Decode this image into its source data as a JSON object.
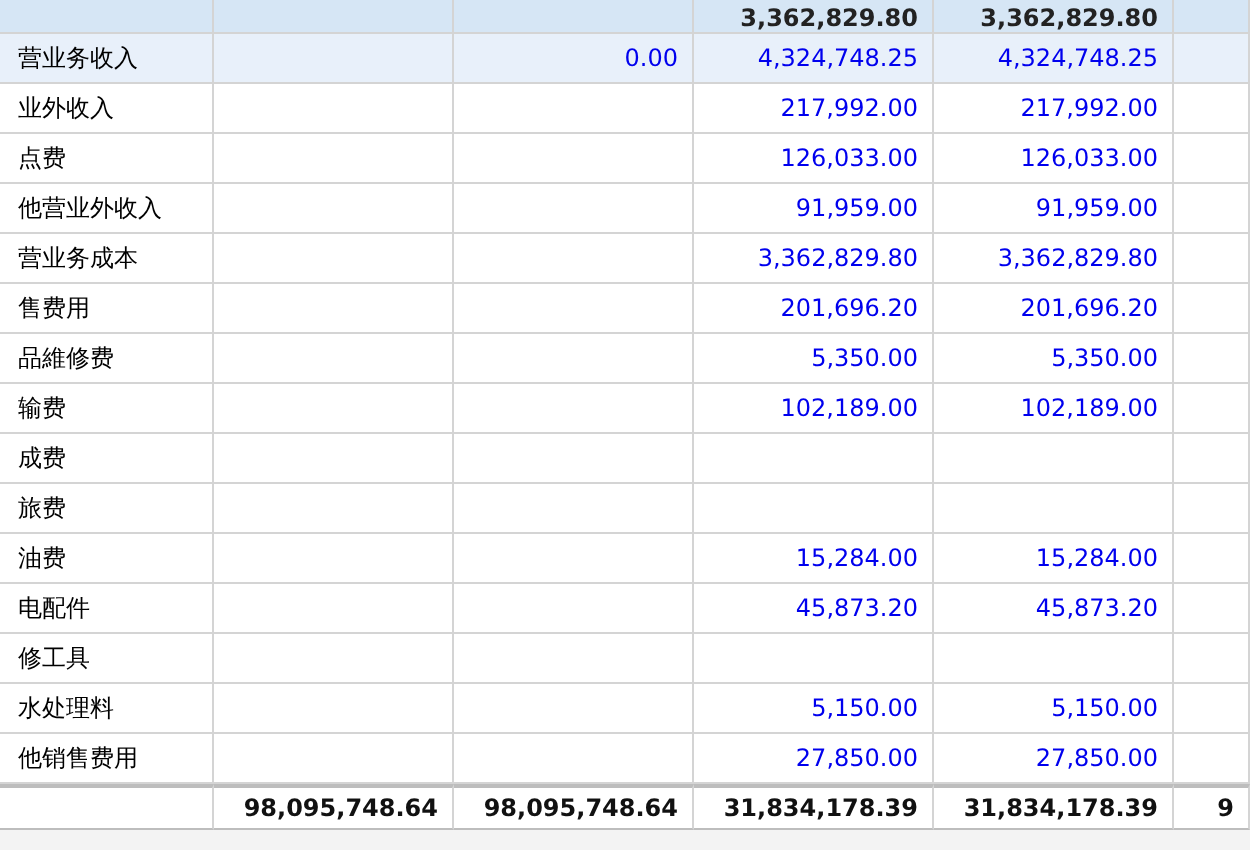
{
  "header": {
    "column_4": "3,362,829.80",
    "column_5": "3,362,829.80"
  },
  "rows": [
    {
      "name": "营业务收入",
      "selected": true,
      "column_3": "0.00",
      "column_4": "4,324,748.25",
      "column_5": "4,324,748.25"
    },
    {
      "name": "业外收入",
      "selected": false,
      "column_4": "217,992.00",
      "column_5": "217,992.00"
    },
    {
      "name": "点费",
      "selected": false,
      "column_4": "126,033.00",
      "column_5": "126,033.00"
    },
    {
      "name": "他营业外收入",
      "selected": false,
      "column_4": "91,959.00",
      "column_5": "91,959.00"
    },
    {
      "name": "营业务成本",
      "selected": false,
      "column_4": "3,362,829.80",
      "column_5": "3,362,829.80"
    },
    {
      "name": "售费用",
      "selected": false,
      "column_4": "201,696.20",
      "column_5": "201,696.20"
    },
    {
      "name": "品維修费",
      "selected": false,
      "column_4": "5,350.00",
      "column_5": "5,350.00"
    },
    {
      "name": "输费",
      "selected": false,
      "column_4": "102,189.00",
      "column_5": "102,189.00"
    },
    {
      "name": "成费",
      "selected": false
    },
    {
      "name": "旅费",
      "selected": false
    },
    {
      "name": "油费",
      "selected": false,
      "column_4": "15,284.00",
      "column_5": "15,284.00"
    },
    {
      "name": "电配件",
      "selected": false,
      "column_4": "45,873.20",
      "column_5": "45,873.20"
    },
    {
      "name": "修工具",
      "selected": false
    },
    {
      "name": "水处理料",
      "selected": false,
      "column_4": "5,150.00",
      "column_5": "5,150.00"
    },
    {
      "name": "他销售费用",
      "selected": false,
      "column_4": "27,850.00",
      "column_5": "27,850.00"
    }
  ],
  "totals": {
    "column_2": "98,095,748.64",
    "column_3": "98,095,748.64",
    "column_4": "31,834,178.39",
    "column_5": "31,834,178.39",
    "column_6": "9"
  }
}
